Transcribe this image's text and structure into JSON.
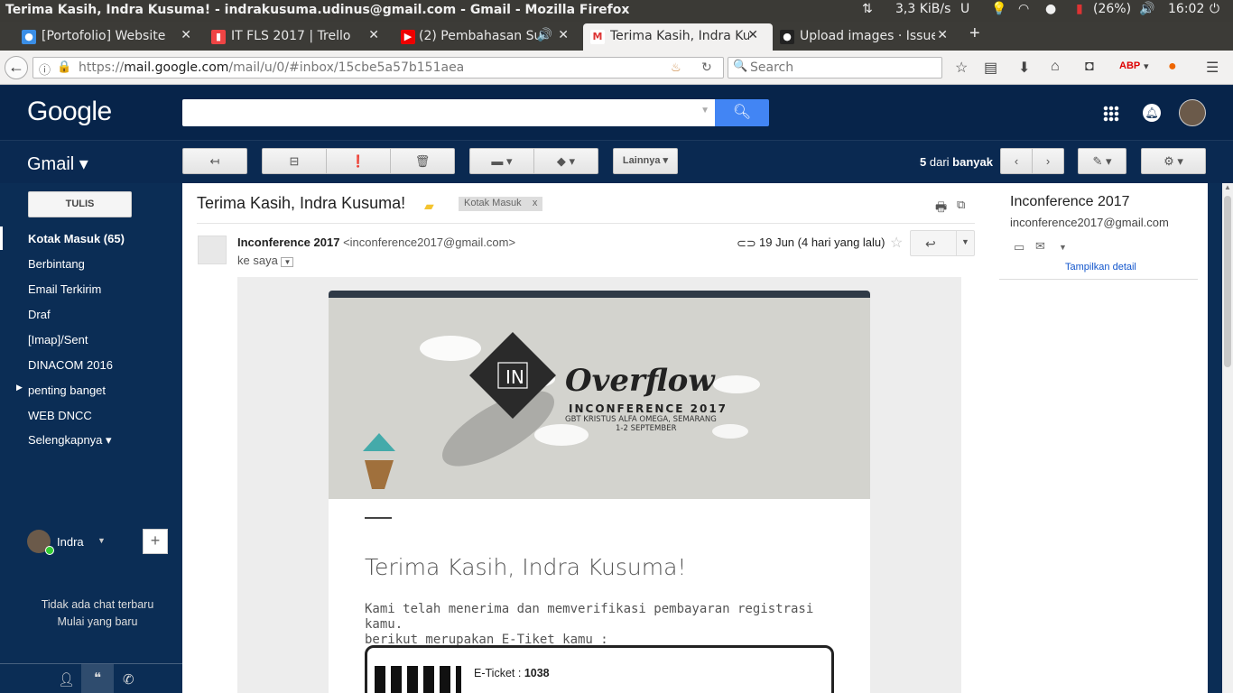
{
  "system": {
    "window_title": "Terima Kasih, Indra Kusuma! - indrakusuma.udinus@gmail.com - Gmail - Mozilla Firefox",
    "net_speed": "3,3 KiB/s",
    "battery": "(26%)",
    "time": "16:02"
  },
  "tabs": [
    {
      "title": "[Portofolio] Website V",
      "favicon_color": "#3a8ee6"
    },
    {
      "title": "IT FLS 2017 | Trello",
      "favicon_color": "#e44"
    },
    {
      "title": "(2) Pembahasan Su",
      "favicon_color": "#e00"
    },
    {
      "title": "Terima Kasih, Indra Ku",
      "favicon_color": "#d33"
    },
    {
      "title": "Upload images · Issue",
      "favicon_color": "#222"
    }
  ],
  "browser": {
    "url_scheme": "https://",
    "url_host": "mail.google.com",
    "url_path": "/mail/u/0/#inbox/15cbe5a57b151aea",
    "search_placeholder": "Search"
  },
  "gmail": {
    "logo": "Google",
    "app_label": "Gmail ▾",
    "more_label": "Lainnya ▾",
    "pager_count": "5",
    "pager_of": "dari",
    "pager_total": "banyak",
    "compose_label": "TULIS",
    "nav_items": [
      {
        "label": "Kotak Masuk (65)"
      },
      {
        "label": "Berbintang"
      },
      {
        "label": "Email Terkirim"
      },
      {
        "label": "Draf"
      },
      {
        "label": "[Imap]/Sent"
      },
      {
        "label": "DINACOM 2016"
      },
      {
        "label": "penting banget"
      },
      {
        "label": "WEB DNCC"
      },
      {
        "label": "Selengkapnya ▾"
      }
    ],
    "chat_user": "Indra",
    "no_chat_line1": "Tidak ada chat terbaru",
    "no_chat_line2": "Mulai yang baru"
  },
  "email": {
    "subject": "Terima Kasih, Indra Kusuma!",
    "label": "Kotak Masuk",
    "label_close": "x",
    "sender_name": "Inconference 2017",
    "sender_email": "<inconference2017@gmail.com>",
    "to": "ke saya",
    "date": "19 Jun (4 hari yang lalu)",
    "body_title": "Terima Kasih, Indra Kusuma!",
    "body_line1": "Kami telah menerima dan memverifikasi pembayaran registrasi kamu.",
    "body_line2": "berikut merupakan E-Tiket kamu :",
    "ticket_label": "E-Ticket :",
    "ticket_number": "1038",
    "banner_title": "Overflow",
    "banner_event": "INCONFERENCE 2017",
    "banner_venue": "GBT KRISTUS ALFA OMEGA, SEMARANG",
    "banner_date": "1-2 SEPTEMBER",
    "banner_logo": "IN"
  },
  "contact_panel": {
    "name": "Inconference 2017",
    "email": "inconference2017@gmail.com",
    "details_link": "Tampilkan detail"
  }
}
